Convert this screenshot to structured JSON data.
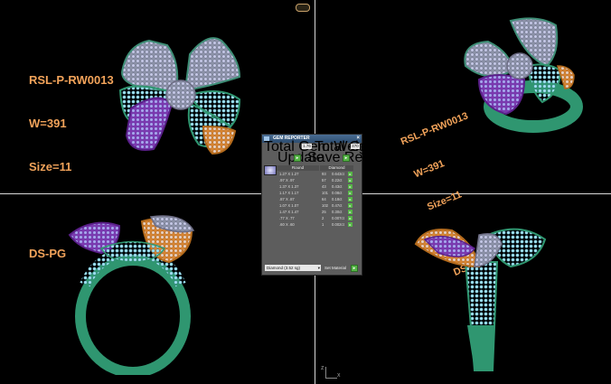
{
  "labels": {
    "top_left": [
      "RSL-P-RW0013",
      "W=391",
      "Size=11",
      "",
      "DS-PG"
    ],
    "top_right": [
      "RSL-P-RW0013",
      "W=391",
      "Size=11",
      "",
      "DS-PG"
    ]
  },
  "panel": {
    "title": "GEM REPORTER",
    "close": "×",
    "total_weight_label": "Total Gem Weight",
    "total_weight_value": "1.76",
    "total_count_label": "Total Gem Count",
    "total_count_value": "470",
    "update_label": "Update",
    "save_label": "Save Report",
    "col_size": "Round",
    "col_type": "Diamond",
    "rows": [
      {
        "size": "1.27 X 1.27",
        "count": "93",
        "weight": "0.643ct"
      },
      {
        "size": ".97 X .97",
        "count": "57",
        "weight": "0.22ct"
      },
      {
        "size": "1.37 X 1.37",
        "count": "43",
        "weight": "0.43ct"
      },
      {
        "size": "1.17 X 1.17",
        "count": "101",
        "weight": "0.08ct"
      },
      {
        "size": ".87 X .87",
        "count": "64",
        "weight": "0.18ct"
      },
      {
        "size": "1.07 X 1.07",
        "count": "102",
        "weight": "0.47ct"
      },
      {
        "size": "1.47 X 1.47",
        "count": "25",
        "weight": "0.30ct"
      },
      {
        "size": ".77 X .77",
        "count": "2",
        "weight": "0.007ct"
      },
      {
        "size": ".60 X .60",
        "count": "1",
        "weight": "0.002ct"
      }
    ],
    "material_select": "Diamond      (3.52 sg)",
    "set_material": "Set Material"
  },
  "colors": {
    "label": "#f2a35a",
    "metal": "#2f9670",
    "gem": "#8fd7ea",
    "purple": "#7d37b0",
    "orange": "#d88430",
    "grey": "#8f8f9a"
  }
}
